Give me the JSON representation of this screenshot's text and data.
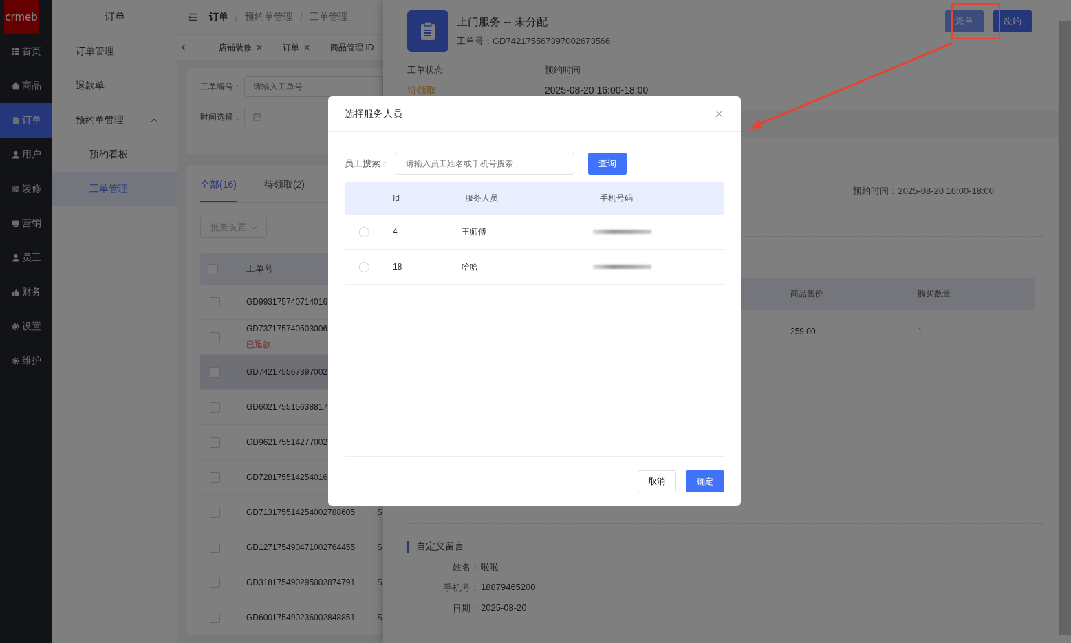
{
  "sidebar": {
    "logo": "crmeb",
    "items": [
      {
        "label": "首页",
        "selected": false
      },
      {
        "label": "商品",
        "selected": false
      },
      {
        "label": "订单",
        "selected": true
      },
      {
        "label": "用户",
        "selected": false
      },
      {
        "label": "装修",
        "selected": false
      },
      {
        "label": "营销",
        "selected": false
      },
      {
        "label": "员工",
        "selected": false
      },
      {
        "label": "财务",
        "selected": false
      },
      {
        "label": "设置",
        "selected": false
      },
      {
        "label": "维护",
        "selected": false
      }
    ]
  },
  "submenu": {
    "title": "订单",
    "items": [
      {
        "label": "订单管理",
        "selected": false
      },
      {
        "label": "退款单",
        "selected": false
      },
      {
        "label": "预约单管理",
        "selected": false,
        "expanded": true,
        "children": [
          {
            "label": "预约看板",
            "selected": false
          },
          {
            "label": "工单管理",
            "selected": true
          }
        ]
      }
    ]
  },
  "breadcrumb": [
    {
      "label": "订单"
    },
    {
      "separator": "/",
      "label": "预约单管理"
    },
    {
      "separator": "/",
      "label": "工单管理"
    }
  ],
  "tags": [
    {
      "label": "店铺装修",
      "closable": true
    },
    {
      "label": "订单",
      "closable": true
    },
    {
      "label": "商品管理 ID",
      "closable": false
    }
  ],
  "filters": [
    {
      "kind": "text",
      "label": "工单编号：",
      "placeholder": "请输入工单号"
    },
    {
      "kind": "date",
      "label": "时间选择："
    }
  ],
  "list": {
    "tabs": [
      {
        "label": "全部(16)",
        "selected": true
      },
      {
        "label": "待领取(2)",
        "selected": false
      }
    ],
    "batch_button": "批量设置",
    "header_checked": false,
    "columns": [
      "工单号"
    ],
    "rows": [
      {
        "id": "GD993175740714016",
        "checked": false,
        "highlighted": false
      },
      {
        "id": "GD737175740503006",
        "note": "已退款",
        "checked": false,
        "highlighted": false
      },
      {
        "id": "GD742175567397002",
        "checked": false,
        "highlighted": true
      },
      {
        "id": "GD602175515638817",
        "checked": false,
        "highlighted": false
      },
      {
        "id": "GD962175514277002",
        "checked": false,
        "highlighted": false
      },
      {
        "id": "GD728175514254016",
        "checked": false,
        "highlighted": false
      },
      {
        "id": "GD713175514254002788605",
        "column_2": "S",
        "checked": false,
        "highlighted": false
      },
      {
        "id": "GD127175490471002764455",
        "column_2": "S",
        "checked": false,
        "highlighted": false
      },
      {
        "id": "GD318175490295002874791",
        "column_2": "S",
        "checked": false,
        "highlighted": false
      },
      {
        "id": "GD600175490236002848851",
        "column_2": "S",
        "checked": false,
        "highlighted": false
      }
    ]
  },
  "drawer": {
    "title": "上门服务 -- 未分配",
    "order_no": "工单号：GD742175567397002673566",
    "buttons": [
      {
        "label": "派单",
        "highlighted": true
      },
      {
        "label": "改约",
        "highlighted": false
      }
    ],
    "info": [
      {
        "label": "工单状态",
        "value": "待领取",
        "kind": "warning"
      },
      {
        "label": "预约时间",
        "value": "2025-08-20   16:00-18:00",
        "kind": "normal"
      }
    ],
    "appointment": "预约时间：2025-08-20   16:00-18:00",
    "products": {
      "columns": [
        "商品售价",
        "购买数量"
      ],
      "rows": [
        [
          "259.00",
          "1"
        ]
      ]
    },
    "message": {
      "title": "自定义留言",
      "fields": [
        {
          "label": "姓名：",
          "value": "啦啦"
        },
        {
          "label": "手机号：",
          "value": "18879465200"
        },
        {
          "label": "日期：",
          "value": "2025-08-20"
        }
      ]
    }
  },
  "modal": {
    "title": "选择服务人员",
    "search_label": "员工搜索：",
    "search_placeholder": "请输入员工姓名或手机号搜索",
    "search_button": "查询",
    "columns": [
      "Id",
      "服务人员",
      "手机号码"
    ],
    "rows": [
      {
        "id": "4",
        "name": "王师傅",
        "selected": false
      },
      {
        "id": "18",
        "name": "哈哈",
        "selected": false
      }
    ],
    "cancel": "取消",
    "confirm": "确定"
  }
}
